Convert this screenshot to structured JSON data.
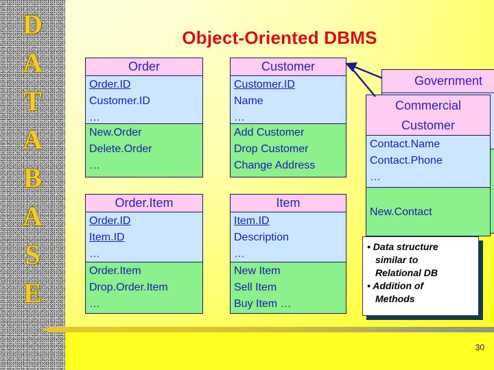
{
  "slide": {
    "title": "Object-Oriented DBMS",
    "page_number": "30",
    "title_color": "#d90b16",
    "background_color": "#ffff33",
    "sidebar_word": "DATABASE",
    "sidebar_letters": [
      "D",
      "A",
      "T",
      "A",
      "B",
      "A",
      "S",
      "E"
    ],
    "sidebar_letter_color": "#f2cc2e"
  },
  "palette": {
    "header_fill": "#ffccf2",
    "attributes_fill": "#cce6ff",
    "operations_fill": "#8cf08c",
    "box_border": "#1b1b55",
    "text_color": "#1a1ab0",
    "arrow_color": "#1a1a8c",
    "note_shadow": "#143a55"
  },
  "classes": {
    "order": {
      "name": "Order",
      "attributes": [
        "Order.ID",
        "Customer.ID",
        "…"
      ],
      "operations": [
        "New.Order",
        "Delete.Order",
        "…"
      ],
      "key_attribute": "Order.ID"
    },
    "customer": {
      "name": "Customer",
      "attributes": [
        "Customer.ID",
        "Name",
        "…"
      ],
      "operations": [
        "Add Customer",
        "Drop Customer",
        "Change Address"
      ],
      "key_attribute": "Customer.ID"
    },
    "orderitem": {
      "name": "Order.Item",
      "attributes": [
        "Order.ID",
        "Item.ID",
        "…"
      ],
      "operations": [
        "Order.Item",
        "Drop.Order.Item",
        "…"
      ],
      "key_attributes": [
        "Order.ID",
        "Item.ID"
      ]
    },
    "item": {
      "name": "Item",
      "attributes": [
        "Item.ID",
        "Description",
        "…"
      ],
      "operations": [
        "New Item",
        "Sell Item",
        "Buy Item …"
      ],
      "key_attribute": "Item.ID"
    },
    "government": {
      "name": "Government",
      "attributes": [],
      "operations": []
    },
    "commercial": {
      "name_line1": "Commercial",
      "name_line2": "Customer",
      "attributes": [
        "Contact.Name",
        "Contact.Phone",
        "…"
      ],
      "operations": [
        "New.Contact"
      ]
    }
  },
  "notes": {
    "lines": [
      {
        "text": "• Data structure",
        "style": "bullet"
      },
      {
        "text": "similar to",
        "style": "cont"
      },
      {
        "text": "Relational DB",
        "style": "cont"
      },
      {
        "text": "• Addition of",
        "style": "bullet"
      },
      {
        "text": "Methods",
        "style": "cont"
      }
    ]
  },
  "relationships": [
    {
      "from": "customer",
      "to": "government",
      "type": "generalization"
    },
    {
      "from": "customer",
      "to": "commercial",
      "type": "generalization"
    }
  ]
}
